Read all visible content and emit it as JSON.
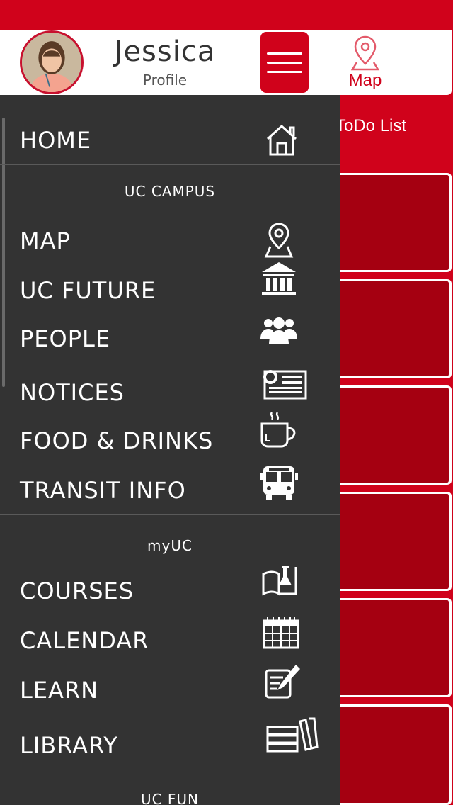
{
  "user": {
    "name": "Jessica",
    "subtitle": "Profile"
  },
  "map_tab": {
    "label": "Map"
  },
  "background": {
    "todo_label": "ToDo List"
  },
  "menu": {
    "home": {
      "label": "HOME",
      "icon": "home-icon"
    },
    "sections": {
      "campus": "UC CAMPUS",
      "myuc": "myUC",
      "fun": "UC FUN"
    },
    "campus_items": [
      {
        "label": "MAP",
        "icon": "map-pin-icon"
      },
      {
        "label": "UC FUTURE",
        "icon": "institution-icon"
      },
      {
        "label": "PEOPLE",
        "icon": "people-icon"
      },
      {
        "label": "NOTICES",
        "icon": "newspaper-icon"
      },
      {
        "label": "FOOD & DRINKS",
        "icon": "coffee-cup-icon"
      },
      {
        "label": "TRANSIT INFO",
        "icon": "bus-icon"
      }
    ],
    "myuc_items": [
      {
        "label": "COURSES",
        "icon": "book-flask-icon"
      },
      {
        "label": "CALENDAR",
        "icon": "calendar-icon"
      },
      {
        "label": "LEARN",
        "icon": "edit-note-icon"
      },
      {
        "label": "LIBRARY",
        "icon": "books-icon"
      }
    ]
  },
  "colors": {
    "brand_red": "#d0021b",
    "tile_red": "#a50011",
    "drawer_bg": "#333333",
    "text_white": "#ffffff"
  }
}
